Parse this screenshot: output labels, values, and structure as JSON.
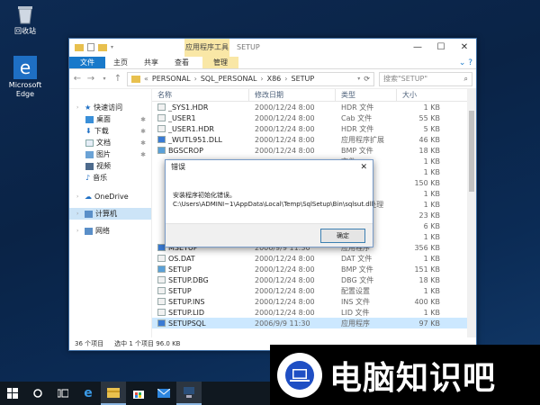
{
  "desktop": {
    "icons": [
      {
        "label": "回收站"
      },
      {
        "label": "Microsoft Edge"
      }
    ]
  },
  "window": {
    "context_tab": "应用程序工具",
    "title": "SETUP",
    "ribbon_tabs": [
      "文件",
      "主页",
      "共享",
      "查看",
      "管理"
    ],
    "address": {
      "segments": [
        "PERSONAL",
        "SQL_PERSONAL",
        "X86",
        "SETUP"
      ],
      "search_placeholder": "搜索\"SETUP\""
    },
    "nav": {
      "quick_access": "快速访问",
      "items": [
        "桌面",
        "下载",
        "文档",
        "图片",
        "视频",
        "音乐"
      ],
      "onedrive": "OneDrive",
      "computer": "计算机",
      "network": "网络"
    },
    "columns": {
      "name": "名称",
      "date": "修改日期",
      "type": "类型",
      "size": "大小"
    },
    "files": [
      {
        "name": "_SYS1.HDR",
        "date": "2000/12/24 8:00",
        "type": "HDR 文件",
        "size": "1 KB"
      },
      {
        "name": "_USER1",
        "date": "2000/12/24 8:00",
        "type": "Cab 文件",
        "size": "55 KB"
      },
      {
        "name": "_USER1.HDR",
        "date": "2000/12/24 8:00",
        "type": "HDR 文件",
        "size": "5 KB"
      },
      {
        "name": "_WUTL951.DLL",
        "date": "2000/12/24 8:00",
        "type": "应用程序扩展",
        "size": "46 KB"
      },
      {
        "name": "BGSCROP",
        "date": "2000/12/24 8:00",
        "type": "BMP 文件",
        "size": "18 KB"
      },
      {
        "name": "",
        "date": "",
        "type": "文件",
        "size": "1 KB"
      },
      {
        "name": "",
        "date": "",
        "type": "文件",
        "size": "1 KB"
      },
      {
        "name": "",
        "date": "",
        "type": "文件",
        "size": "150 KB"
      },
      {
        "name": "",
        "date": "",
        "type": "件",
        "size": "1 KB"
      },
      {
        "name": "",
        "date": "",
        "type": "dows 批处理",
        "size": "1 KB"
      },
      {
        "name": "",
        "date": "",
        "type": "文件",
        "size": "23 KB"
      },
      {
        "name": "",
        "date": "",
        "type": "文件",
        "size": "6 KB"
      },
      {
        "name": "",
        "date": "",
        "type": "文件",
        "size": "1 KB"
      },
      {
        "name": "MSETUP",
        "date": "2006/9/9 11:30",
        "type": "应用程序",
        "size": "356 KB"
      },
      {
        "name": "OS.DAT",
        "date": "2000/12/24 8:00",
        "type": "DAT 文件",
        "size": "1 KB"
      },
      {
        "name": "SETUP",
        "date": "2000/12/24 8:00",
        "type": "BMP 文件",
        "size": "151 KB"
      },
      {
        "name": "SETUP.DBG",
        "date": "2000/12/24 8:00",
        "type": "DBG 文件",
        "size": "18 KB"
      },
      {
        "name": "SETUP",
        "date": "2000/12/24 8:00",
        "type": "配置设置",
        "size": "1 KB"
      },
      {
        "name": "SETUP.INS",
        "date": "2000/12/24 8:00",
        "type": "INS 文件",
        "size": "400 KB"
      },
      {
        "name": "SETUP.LID",
        "date": "2000/12/24 8:00",
        "type": "LID 文件",
        "size": "1 KB"
      },
      {
        "name": "SETUPSQL",
        "date": "2006/9/9 11:30",
        "type": "应用程序",
        "size": "97 KB"
      }
    ],
    "status": {
      "count": "36 个项目",
      "selected": "选中 1 个项目 96.0 KB"
    }
  },
  "dialog": {
    "title": "错误",
    "line1": "安装程序初始化错误。",
    "line2": "C:\\Users\\ADMINI~1\\AppData\\Local\\Temp\\SqlSetup\\Bin\\sqlsut.dll",
    "ok": "确定"
  },
  "watermark": {
    "text": "电脑知识吧"
  },
  "colors": {
    "accent": "#1979ca",
    "selection": "#cce8ff",
    "context": "#f9e7a6"
  }
}
